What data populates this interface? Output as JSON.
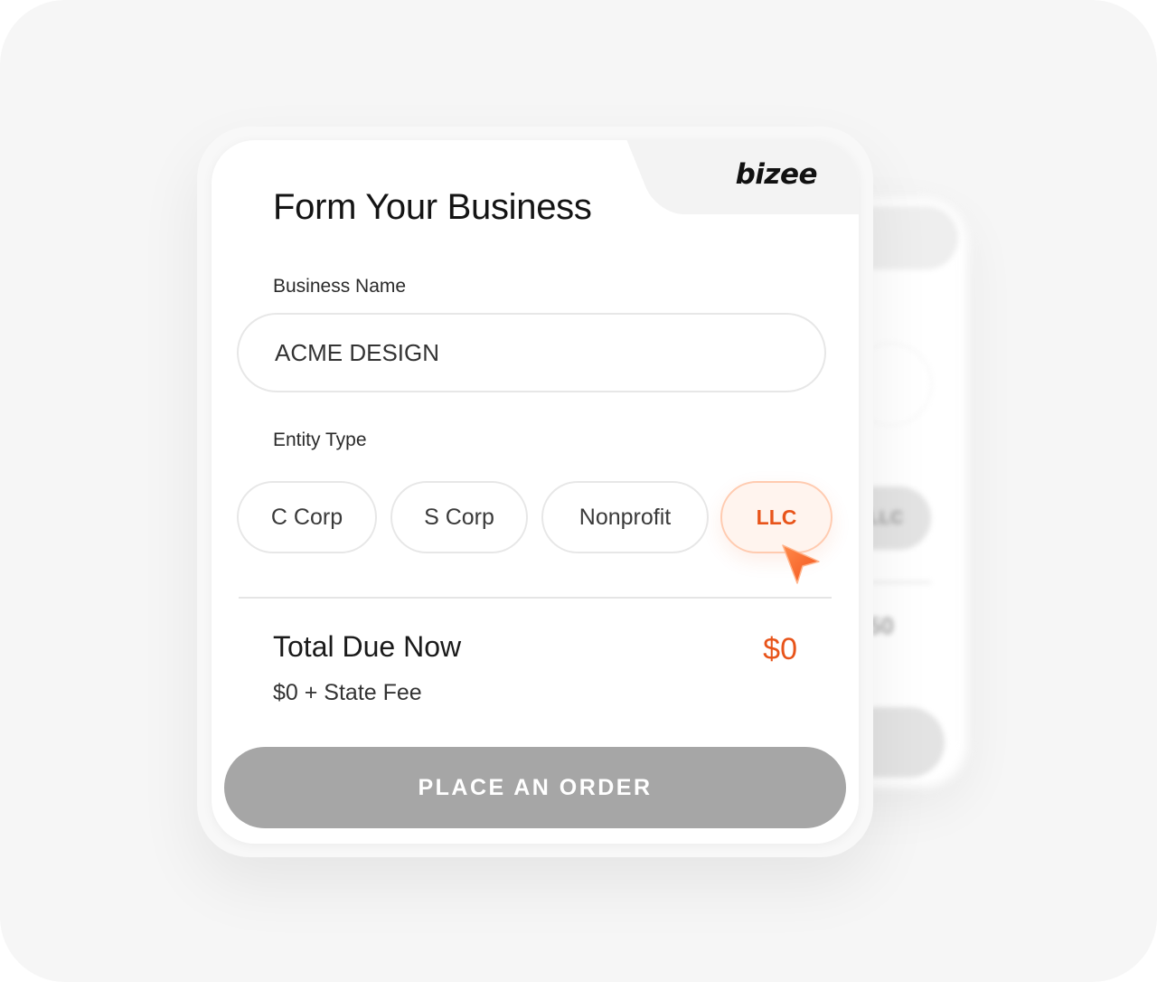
{
  "brand": {
    "logo_text": "bizee"
  },
  "form": {
    "title": "Form Your Business",
    "business_name_label": "Business Name",
    "business_name_value": "ACME DESIGN",
    "entity_type_label": "Entity Type",
    "entity_types": [
      {
        "label": "C Corp",
        "selected": false
      },
      {
        "label": "S Corp",
        "selected": false
      },
      {
        "label": "Nonprofit",
        "selected": false
      },
      {
        "label": "LLC",
        "selected": true
      }
    ]
  },
  "summary": {
    "total_label": "Total Due Now",
    "total_value": "$0",
    "fee_text": "$0 + State Fee"
  },
  "actions": {
    "order_label": "PLACE AN ORDER"
  },
  "background_card": {
    "chip_label": "LLC",
    "price_fragment": "50"
  },
  "colors": {
    "accent": "#e8541a",
    "button_disabled": "#a6a6a6",
    "background": "#f6f6f6"
  },
  "icons": {
    "cursor": "cursor-pointer-icon"
  }
}
